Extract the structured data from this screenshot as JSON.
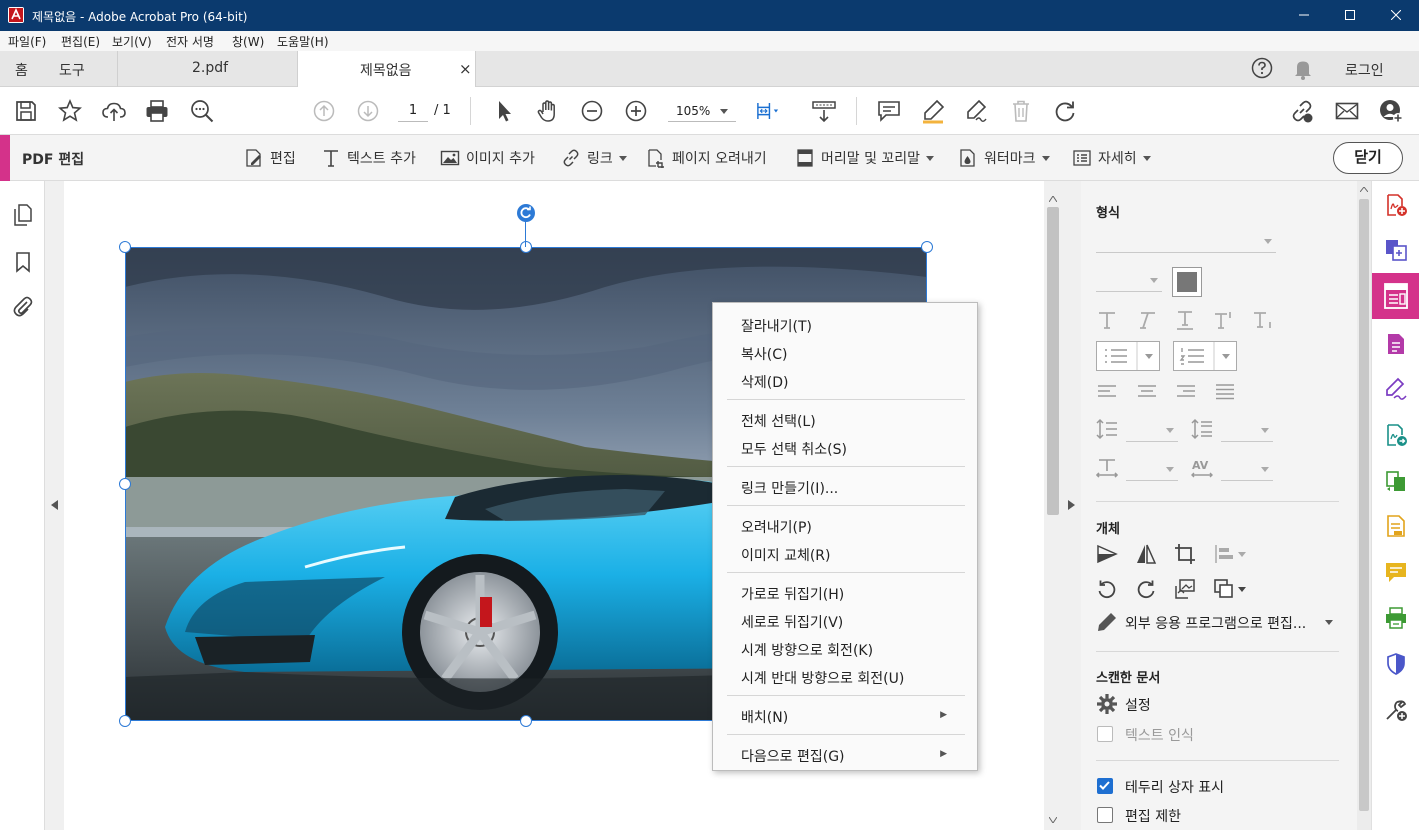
{
  "window": {
    "title": "제목없음 - Adobe Acrobat Pro (64-bit)"
  },
  "menu": [
    "파일(F)",
    "편집(E)",
    "보기(V)",
    "전자 서명",
    "창(W)",
    "도움말(H)"
  ],
  "tabs": {
    "home": "홈",
    "tools": "도구",
    "doc1": "2.pdf",
    "doc2": "제목없음",
    "close": "×",
    "login": "로그인"
  },
  "toolbar": {
    "page_current": "1",
    "page_total": "/ 1",
    "zoom": "105%"
  },
  "editbar": {
    "title": "PDF 편집",
    "tools": [
      "편집",
      "텍스트 추가",
      "이미지 추가",
      "링크",
      "페이지 오려내기",
      "머리말 및 꼬리말",
      "워터마크",
      "자세히"
    ],
    "close": "닫기"
  },
  "context_menu": {
    "groups": [
      [
        "잘라내기(T)",
        "복사(C)",
        "삭제(D)"
      ],
      [
        "전체 선택(L)",
        "모두 선택 취소(S)"
      ],
      [
        "링크 만들기(I)..."
      ],
      [
        "오려내기(P)",
        "이미지 교체(R)"
      ],
      [
        "가로로 뒤집기(H)",
        "세로로 뒤집기(V)",
        "시계 방향으로 회전(K)",
        "시계 반대 방향으로 회전(U)"
      ],
      [
        "배치(N)"
      ],
      [
        "다음으로 편집(G)"
      ]
    ]
  },
  "panel": {
    "format_title": "형식",
    "object_title": "개체",
    "edit_external": "외부 응용 프로그램으로 편집...",
    "scanned_title": "스캔한 문서",
    "settings": "설정",
    "text_recognition": "텍스트 인식",
    "show_bbox": "테두리 상자 표시",
    "restrict_edit": "편집 제한",
    "show_bbox_checked": true,
    "restrict_edit_checked": false
  },
  "colors": {
    "accent": "#d4328a",
    "selection": "#2d7ad6",
    "titlebar": "#0b3a6e"
  }
}
